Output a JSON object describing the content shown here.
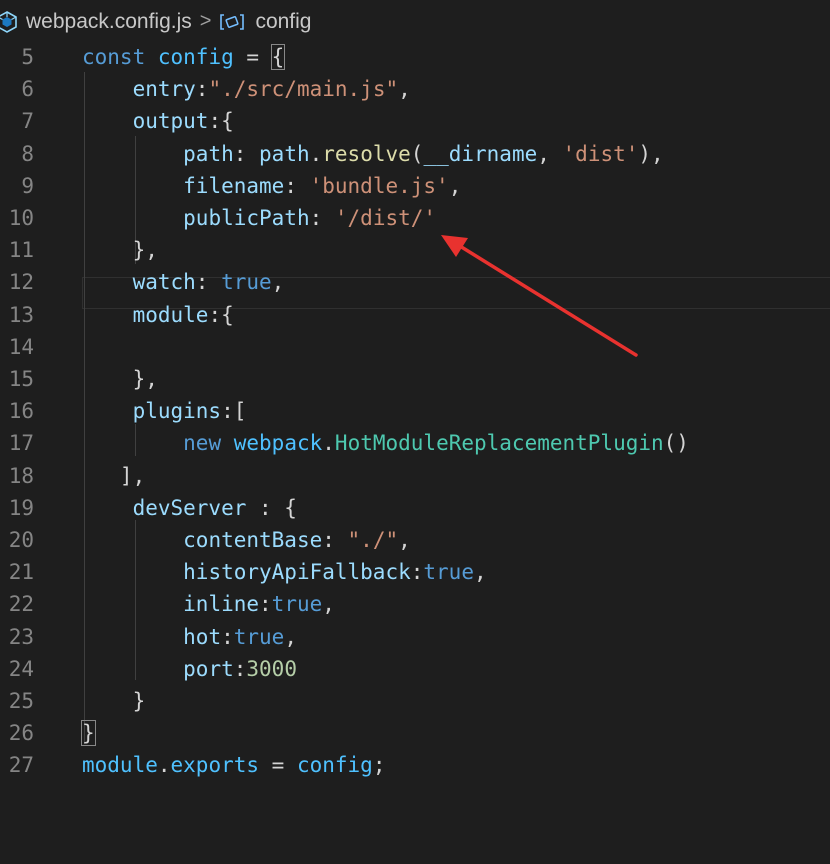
{
  "breadcrumb": {
    "file_name": "webpack.config.js",
    "separator": ">",
    "symbol_name": "config",
    "file_icon": "webpack-cube-icon",
    "symbol_icon": "variable-symbol-icon"
  },
  "editor": {
    "lines": [
      {
        "num": "5",
        "tokens": [
          [
            "k",
            "const"
          ],
          [
            "d",
            " "
          ],
          [
            "v",
            "config"
          ],
          [
            "d",
            " = "
          ],
          [
            "bb",
            "{"
          ]
        ]
      },
      {
        "num": "6",
        "tokens": [
          [
            "d",
            "    "
          ],
          [
            "p",
            "entry"
          ],
          [
            "d",
            ":"
          ],
          [
            "s",
            "\"./src/main.js\""
          ],
          [
            "d",
            ","
          ]
        ]
      },
      {
        "num": "7",
        "tokens": [
          [
            "d",
            "    "
          ],
          [
            "p",
            "output"
          ],
          [
            "d",
            ":{"
          ]
        ]
      },
      {
        "num": "8",
        "tokens": [
          [
            "d",
            "        "
          ],
          [
            "p",
            "path"
          ],
          [
            "d",
            ": "
          ],
          [
            "p",
            "path"
          ],
          [
            "d",
            "."
          ],
          [
            "f",
            "resolve"
          ],
          [
            "d",
            "("
          ],
          [
            "p",
            "__dirname"
          ],
          [
            "d",
            ", "
          ],
          [
            "s",
            "'dist'"
          ],
          [
            "d",
            "),"
          ]
        ]
      },
      {
        "num": "9",
        "tokens": [
          [
            "d",
            "        "
          ],
          [
            "p",
            "filename"
          ],
          [
            "d",
            ": "
          ],
          [
            "s",
            "'bundle.js'"
          ],
          [
            "d",
            ","
          ]
        ]
      },
      {
        "num": "10",
        "tokens": [
          [
            "d",
            "        "
          ],
          [
            "p",
            "publicPath"
          ],
          [
            "d",
            ": "
          ],
          [
            "s",
            "'/dist/'"
          ]
        ]
      },
      {
        "num": "11",
        "tokens": [
          [
            "d",
            "    },"
          ]
        ]
      },
      {
        "num": "12",
        "tokens": [
          [
            "d",
            "    "
          ],
          [
            "p",
            "watch"
          ],
          [
            "d",
            ": "
          ],
          [
            "k",
            "true"
          ],
          [
            "d",
            ","
          ]
        ]
      },
      {
        "num": "13",
        "tokens": [
          [
            "d",
            "    "
          ],
          [
            "p",
            "module"
          ],
          [
            "d",
            ":{"
          ]
        ]
      },
      {
        "num": "14",
        "tokens": [
          [
            "d",
            ""
          ]
        ]
      },
      {
        "num": "15",
        "tokens": [
          [
            "d",
            "    },"
          ]
        ]
      },
      {
        "num": "16",
        "tokens": [
          [
            "d",
            "    "
          ],
          [
            "p",
            "plugins"
          ],
          [
            "d",
            ":["
          ]
        ]
      },
      {
        "num": "17",
        "tokens": [
          [
            "d",
            "        "
          ],
          [
            "k",
            "new"
          ],
          [
            "d",
            " "
          ],
          [
            "v",
            "webpack"
          ],
          [
            "d",
            "."
          ],
          [
            "c",
            "HotModuleReplacementPlugin"
          ],
          [
            "d",
            "()"
          ]
        ]
      },
      {
        "num": "18",
        "tokens": [
          [
            "d",
            "   ],"
          ]
        ]
      },
      {
        "num": "19",
        "tokens": [
          [
            "d",
            "    "
          ],
          [
            "p",
            "devServer"
          ],
          [
            "d",
            " : {"
          ]
        ]
      },
      {
        "num": "20",
        "tokens": [
          [
            "d",
            "        "
          ],
          [
            "p",
            "contentBase"
          ],
          [
            "d",
            ": "
          ],
          [
            "s",
            "\"./\""
          ],
          [
            "d",
            ","
          ]
        ]
      },
      {
        "num": "21",
        "tokens": [
          [
            "d",
            "        "
          ],
          [
            "p",
            "historyApiFallback"
          ],
          [
            "d",
            ":"
          ],
          [
            "k",
            "true"
          ],
          [
            "d",
            ","
          ]
        ]
      },
      {
        "num": "22",
        "tokens": [
          [
            "d",
            "        "
          ],
          [
            "p",
            "inline"
          ],
          [
            "d",
            ":"
          ],
          [
            "k",
            "true"
          ],
          [
            "d",
            ","
          ]
        ]
      },
      {
        "num": "23",
        "tokens": [
          [
            "d",
            "        "
          ],
          [
            "p",
            "hot"
          ],
          [
            "d",
            ":"
          ],
          [
            "k",
            "true"
          ],
          [
            "d",
            ","
          ]
        ]
      },
      {
        "num": "24",
        "tokens": [
          [
            "d",
            "        "
          ],
          [
            "p",
            "port"
          ],
          [
            "d",
            ":"
          ],
          [
            "n",
            "3000"
          ]
        ]
      },
      {
        "num": "25",
        "tokens": [
          [
            "d",
            "    }"
          ]
        ]
      },
      {
        "num": "26",
        "tokens": [
          [
            "bb",
            "}"
          ]
        ]
      },
      {
        "num": "27",
        "tokens": [
          [
            "v",
            "module"
          ],
          [
            "d",
            "."
          ],
          [
            "v",
            "exports"
          ],
          [
            "d",
            " = "
          ],
          [
            "v",
            "config"
          ],
          [
            "d",
            ";"
          ]
        ]
      }
    ],
    "current_line": "11"
  },
  "annotation": {
    "arrow_color": "#e8322f",
    "arrow_icon": "red-arrow-icon"
  },
  "colors": {
    "background": "#1e1e1e",
    "keyword": "#569cd6",
    "string": "#ce9178",
    "property": "#9cdcfe",
    "function": "#dcdcaa",
    "class": "#4ec9b0",
    "number": "#b5cea8"
  }
}
